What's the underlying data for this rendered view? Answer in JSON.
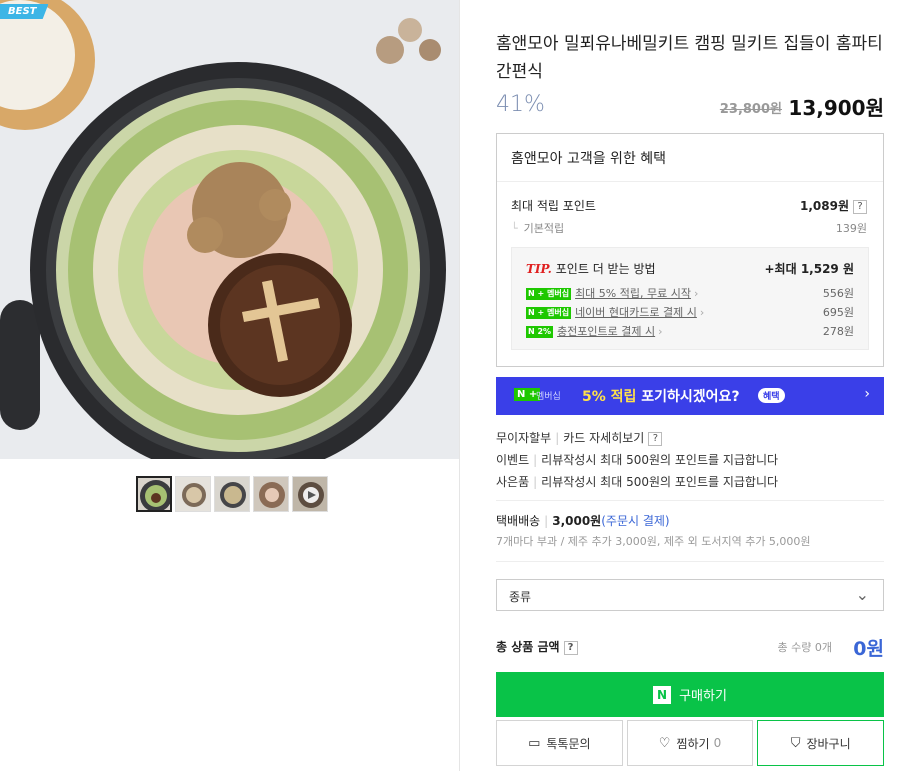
{
  "product": {
    "badge": "BEST",
    "title": "홈앤모아 밀푀유나베밀키트 캠핑 밀키트 집들이 홈파티 간편식",
    "discount": "41%",
    "original_price": "23,800원",
    "sale_price": "13,900원"
  },
  "benefits": {
    "title": "홈앤모아 고객을 위한 혜택",
    "max_points_label": "최대 적립 포인트",
    "max_points_value": "1,089원",
    "basic_label": "기본적립",
    "basic_value": "139원",
    "tip_label": "TIP.",
    "tip_text": "포인트 더 받는 방법",
    "tip_max": "+최대 1,529 원",
    "tip_items": [
      {
        "badge": "N + 멤버십",
        "text": "최대 5% 적립, 무료 시작",
        "value": "556원"
      },
      {
        "badge": "N + 멤버십",
        "text": "네이버 현대카드로 결제 시",
        "value": "695원"
      },
      {
        "badge": "N 2%",
        "text": "충전포인트로 결제 시",
        "value": "278원"
      }
    ]
  },
  "banner": {
    "icon": "N +",
    "icon_sub": "멤버십",
    "highlight": "5% 적립",
    "text": "포기하시겠어요?",
    "pill": "혜택"
  },
  "info": {
    "installment": "무이자할부",
    "card_link": "카드 자세히보기",
    "event_label": "이벤트",
    "event_text": "리뷰작성시 최대 500원의 포인트를 지급합니다",
    "gift_label": "사은품",
    "gift_text": "리뷰작성시 최대 500원의 포인트를 지급합니다"
  },
  "shipping": {
    "label": "택배배송",
    "fee": "3,000원",
    "pay": "(주문시 결제)",
    "sub": "7개마다 부과 / 제주 추가 3,000원, 제주 외 도서지역 추가 5,000원"
  },
  "option": {
    "placeholder": "종류"
  },
  "total": {
    "label": "총 상품 금액",
    "count": "총 수량 0개",
    "amount": "0원"
  },
  "actions": {
    "buy": "구매하기",
    "talk": "톡톡문의",
    "wish": "찜하기",
    "wish_count": "0",
    "cart": "장바구니"
  }
}
